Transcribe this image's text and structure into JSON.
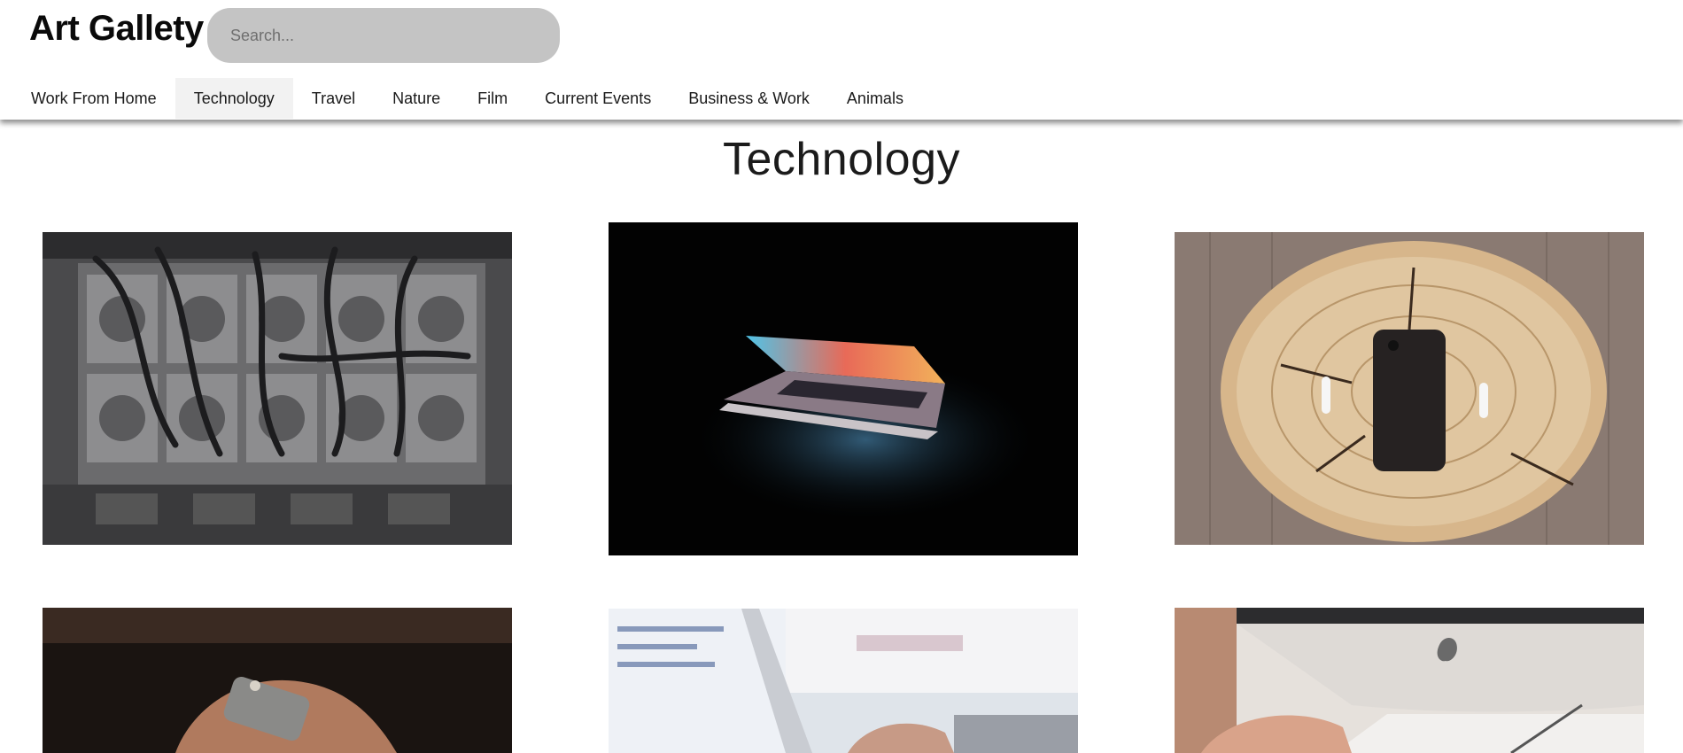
{
  "app": {
    "brand": "Art Gallety"
  },
  "search": {
    "placeholder": "Search..."
  },
  "nav": {
    "items": [
      {
        "label": "Work From Home"
      },
      {
        "label": "Technology"
      },
      {
        "label": "Travel"
      },
      {
        "label": "Nature"
      },
      {
        "label": "Film"
      },
      {
        "label": "Current Events"
      },
      {
        "label": "Business & Work"
      },
      {
        "label": "Animals"
      }
    ],
    "active": "Technology"
  },
  "page": {
    "title": "Technology"
  },
  "colors": {
    "search_bg": "#c4c4c4",
    "active_tab_bg": "#f2f2f2",
    "text": "#111111"
  }
}
